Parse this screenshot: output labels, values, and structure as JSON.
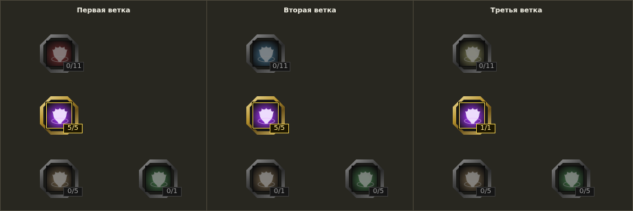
{
  "branches": [
    {
      "title": "Первая ветка",
      "nodes": [
        {
          "count": "0/11",
          "active": false,
          "color": "#b02a2a"
        },
        {
          "count": "5/5",
          "active": true,
          "color": "#8e2fd8"
        },
        {
          "count": "0/5",
          "active": false,
          "color": "#8a6a3a"
        },
        {
          "count": "0/1",
          "active": false,
          "color": "#2b8a35"
        }
      ]
    },
    {
      "title": "Вторая ветка",
      "nodes": [
        {
          "count": "0/11",
          "active": false,
          "color": "#2a78a8"
        },
        {
          "count": "5/5",
          "active": true,
          "color": "#8e2fd8"
        },
        {
          "count": "0/1",
          "active": false,
          "color": "#8a6a3a"
        },
        {
          "count": "0/5",
          "active": false,
          "color": "#2b8a35"
        }
      ]
    },
    {
      "title": "Третья ветка",
      "nodes": [
        {
          "count": "0/11",
          "active": false,
          "color": "#8a8a3a"
        },
        {
          "count": "1/1",
          "active": true,
          "color": "#8e2fd8"
        },
        {
          "count": "0/5",
          "active": false,
          "color": "#8a6a3a"
        },
        {
          "count": "0/5",
          "active": false,
          "color": "#2b8a35"
        }
      ]
    }
  ],
  "icon_name": "skill-emblem-icon"
}
